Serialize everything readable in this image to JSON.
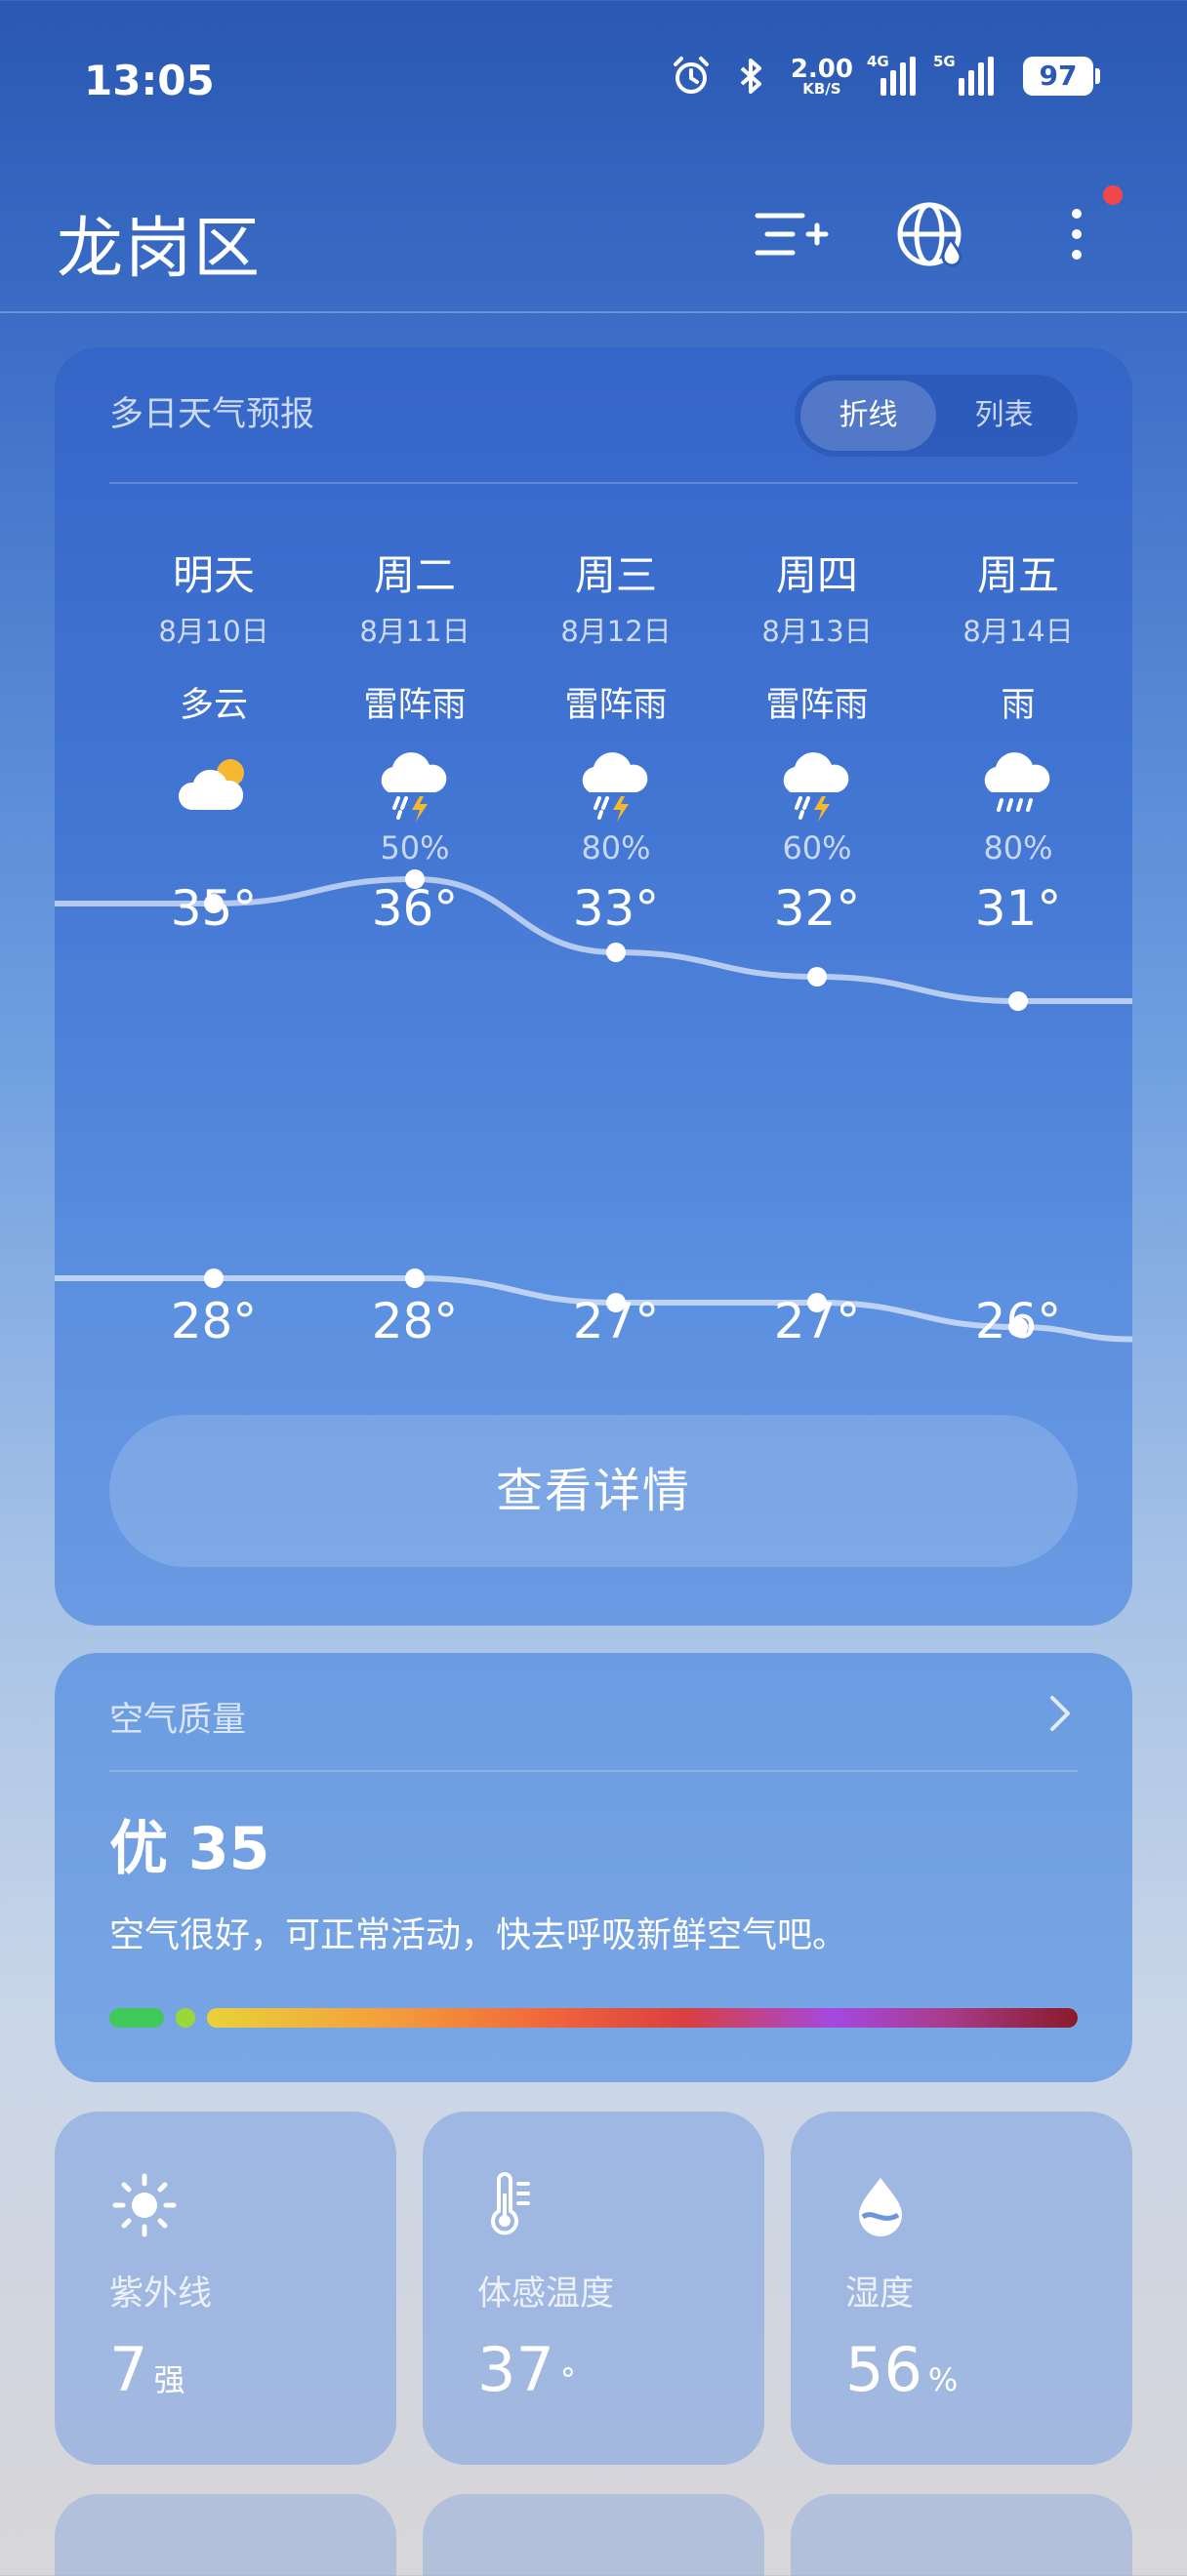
{
  "status": {
    "time": "13:05",
    "net_speed": "2.00",
    "net_unit": "KB/S",
    "sig1_label": "4G",
    "sig2_label": "5G",
    "battery": "97"
  },
  "header": {
    "city": "龙岗区"
  },
  "forecast": {
    "title": "多日天气预报",
    "toggle": [
      "折线",
      "列表"
    ],
    "days": [
      {
        "name": "明天",
        "date": "8月10日",
        "cond": "多云",
        "icon": "partly-cloudy-icon",
        "pop": "",
        "hi": "35°",
        "lo": "28°",
        "hi_v": 35,
        "lo_v": 28
      },
      {
        "name": "周二",
        "date": "8月11日",
        "cond": "雷阵雨",
        "icon": "thunderstorm-icon",
        "pop": "50%",
        "hi": "36°",
        "lo": "28°",
        "hi_v": 36,
        "lo_v": 28
      },
      {
        "name": "周三",
        "date": "8月12日",
        "cond": "雷阵雨",
        "icon": "thunderstorm-icon",
        "pop": "80%",
        "hi": "33°",
        "lo": "27°",
        "hi_v": 33,
        "lo_v": 27
      },
      {
        "name": "周四",
        "date": "8月13日",
        "cond": "雷阵雨",
        "icon": "thunderstorm-icon",
        "pop": "60%",
        "hi": "32°",
        "lo": "27°",
        "hi_v": 32,
        "lo_v": 27
      },
      {
        "name": "周五",
        "date": "8月14日",
        "cond": "雨",
        "icon": "rain-icon",
        "pop": "80%",
        "hi": "31°",
        "lo": "26°",
        "hi_v": 31,
        "lo_v": 26
      }
    ],
    "detail_button": "查看详情"
  },
  "aqi": {
    "title": "空气质量",
    "value": "优 35",
    "desc": "空气很好，可正常活动，快去呼吸新鲜空气吧。"
  },
  "tiles": [
    {
      "label": "紫外线",
      "value": "7",
      "unit": "强",
      "icon": "sun-icon"
    },
    {
      "label": "体感温度",
      "value": "37",
      "unit": "°",
      "icon": "thermometer-icon"
    },
    {
      "label": "湿度",
      "value": "56",
      "unit": "%",
      "icon": "humidity-icon"
    }
  ]
}
